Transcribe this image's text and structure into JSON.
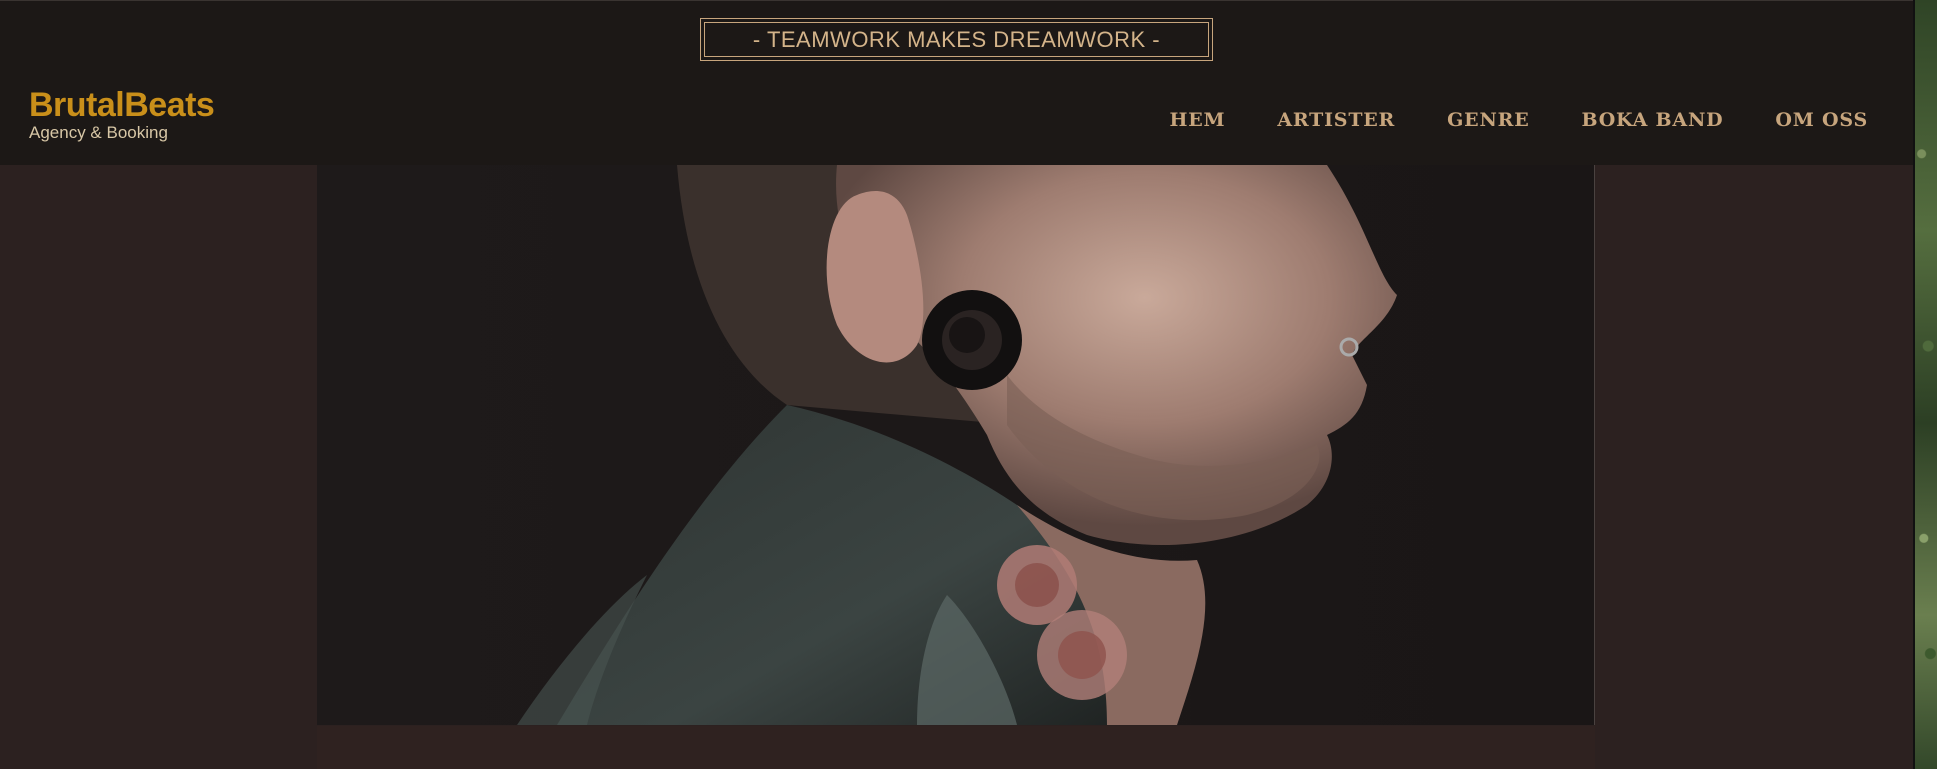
{
  "tagline": "- TEAMWORK MAKES DREAMWORK -",
  "logo": {
    "title": "BrutalBeats",
    "subtitle": "Agency & Booking"
  },
  "nav": {
    "items": [
      {
        "label": "HEM"
      },
      {
        "label": "ARTISTER"
      },
      {
        "label": "GENRE"
      },
      {
        "label": "BOKA BAND"
      },
      {
        "label": "OM OSS"
      }
    ]
  },
  "hero": {
    "image": "tattooed-man-profile-photo"
  },
  "colors": {
    "header_bg": "#1c1816",
    "page_bg": "#2c2120",
    "brand_gold": "#c98f1a",
    "nav_text": "#c7a57d"
  }
}
